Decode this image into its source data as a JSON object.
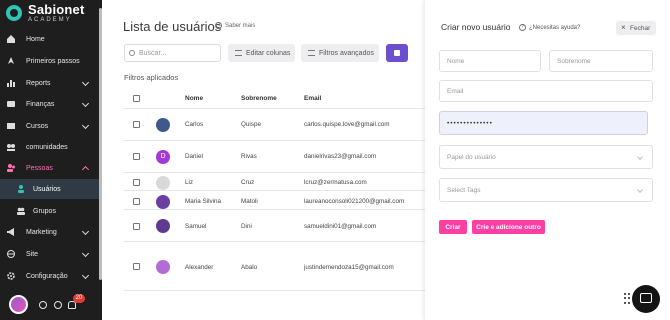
{
  "brand": {
    "name": "Sabionet",
    "tagline": "ACADEMY",
    "accent": "#ff3fa4",
    "primary": "#6c4fcf"
  },
  "sidebar": {
    "items": [
      {
        "label": "Home",
        "icon": "home-icon"
      },
      {
        "label": "Primeiros passos",
        "icon": "rocket-icon"
      },
      {
        "label": "Reports",
        "icon": "chart-icon",
        "chevron": "down"
      },
      {
        "label": "Finanças",
        "icon": "wallet-icon",
        "chevron": "down"
      },
      {
        "label": "Cursos",
        "icon": "book-icon",
        "chevron": "down"
      },
      {
        "label": "comunidades",
        "icon": "community-icon"
      },
      {
        "label": "Pessoas",
        "icon": "people-icon",
        "chevron": "up"
      },
      {
        "label": "Usuários",
        "icon": "user-icon"
      },
      {
        "label": "Grupos",
        "icon": "group-icon"
      },
      {
        "label": "Marketing",
        "icon": "megaphone-icon",
        "chevron": "down"
      },
      {
        "label": "Site",
        "icon": "globe-icon",
        "chevron": "down"
      },
      {
        "label": "Configuração",
        "icon": "gear-icon",
        "chevron": "down"
      }
    ],
    "notification_count": "20"
  },
  "main": {
    "title": "Lista de usuários",
    "help": "Saber mais",
    "search_placeholder": "Buscar...",
    "edit_columns": "Editar colunas",
    "advanced_filters": "Filtros avançados",
    "filters_applied": "Filtros aplicados",
    "columns": [
      "Nome",
      "Sobrenome",
      "Email"
    ],
    "rows": [
      {
        "nome": "Carlos",
        "sobrenome": "Quispe",
        "email": "carlos.quispe.love@gmail.com"
      },
      {
        "nome": "Daniel",
        "sobrenome": "Rivas",
        "email": "danielrivas23@gmail.com",
        "initial": "D"
      },
      {
        "nome": "Liz",
        "sobrenome": "Cruz",
        "email": "lcruz@zermatusa.com"
      },
      {
        "nome": "Maria Silvina",
        "sobrenome": "Matoli",
        "email": "laureanoconsoli021200@gmail.com"
      },
      {
        "nome": "Samuel",
        "sobrenome": "Dini",
        "email": "samueldini01@gmail.com"
      },
      {
        "nome": "Alexander",
        "sobrenome": "Abalo",
        "email": "justindemendoza15@gmail.com"
      }
    ]
  },
  "panel": {
    "title": "Criar novo usuário",
    "help": "¿Necesitas ayuda?",
    "close": "Fechar",
    "nome_placeholder": "Nome",
    "sobrenome_placeholder": "Sobrenome",
    "email_placeholder": "Email",
    "password_value": "••••••••••••••",
    "role_placeholder": "Papel do usuário",
    "tags_placeholder": "Select Tags",
    "create": "Criar",
    "create_add_another": "Crie e adicione outro"
  }
}
